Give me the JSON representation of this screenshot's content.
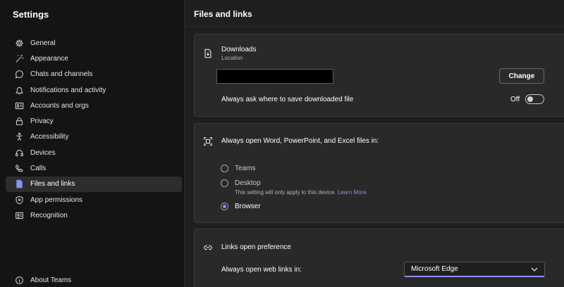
{
  "sidebar": {
    "title": "Settings",
    "items": [
      {
        "label": "General",
        "icon": "gear-icon"
      },
      {
        "label": "Appearance",
        "icon": "magic-wand-icon"
      },
      {
        "label": "Chats and channels",
        "icon": "chat-icon"
      },
      {
        "label": "Notifications and activity",
        "icon": "bell-icon"
      },
      {
        "label": "Accounts and orgs",
        "icon": "id-card-icon"
      },
      {
        "label": "Privacy",
        "icon": "lock-icon"
      },
      {
        "label": "Accessibility",
        "icon": "accessibility-icon"
      },
      {
        "label": "Devices",
        "icon": "headset-icon"
      },
      {
        "label": "Calls",
        "icon": "phone-icon"
      },
      {
        "label": "Files and links",
        "icon": "document-icon"
      },
      {
        "label": "App permissions",
        "icon": "shield-icon"
      },
      {
        "label": "Recognition",
        "icon": "recognition-icon"
      }
    ],
    "active_index": 9,
    "about": {
      "label": "About Teams",
      "icon": "info-icon"
    }
  },
  "main": {
    "title": "Files and links",
    "downloads": {
      "title": "Downloads",
      "subtitle": "Location",
      "change_label": "Change",
      "ask_label": "Always ask where to save downloaded file",
      "toggle_state": "Off"
    },
    "open_files": {
      "title": "Always open Word, PowerPoint, and Excel files in:",
      "options": [
        {
          "label": "Teams",
          "checked": false
        },
        {
          "label": "Desktop",
          "note": "This setting will only apply to this device.",
          "link": "Learn More",
          "checked": false
        },
        {
          "label": "Browser",
          "checked": true
        }
      ]
    },
    "links": {
      "title": "Links open preference",
      "label": "Always open web links in:",
      "selected": "Microsoft Edge"
    }
  },
  "colors": {
    "accent": "#8d91f0",
    "sidebar_bg": "#141414",
    "card_bg": "#292929"
  }
}
